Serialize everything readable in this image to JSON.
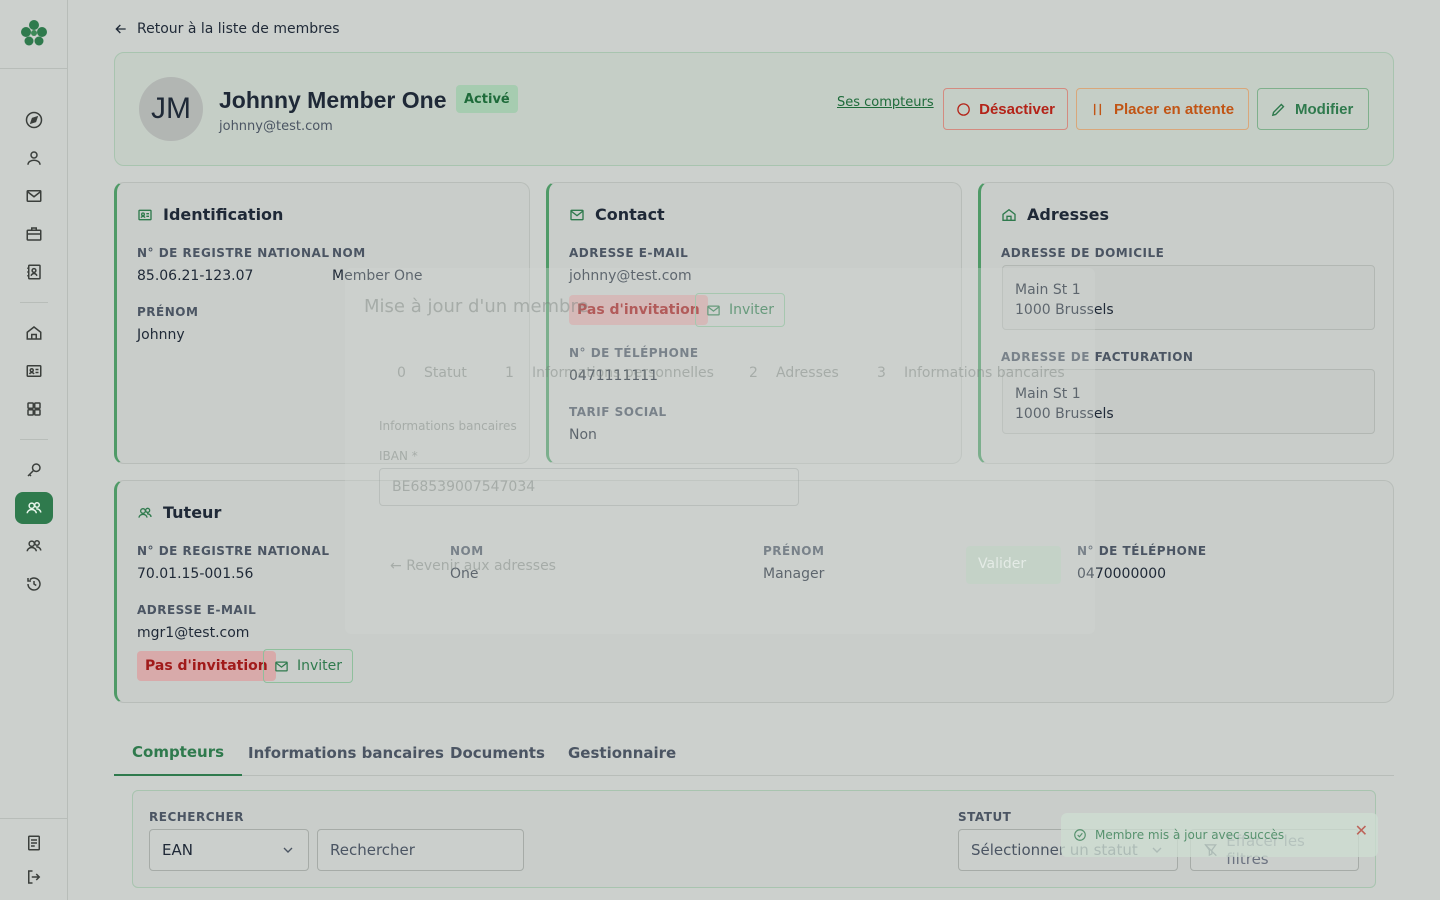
{
  "nav": {
    "back_label": "Retour à la liste de membres"
  },
  "member": {
    "initials": "JM",
    "name": "Johnny Member One",
    "status": "Activé",
    "email": "johnny@test.com",
    "meters_link": "Ses compteurs",
    "deactivate_label": "Désactiver",
    "hold_label": "Placer en attente",
    "edit_label": "Modifier"
  },
  "identification": {
    "title": "Identification",
    "nrn_label": "N° DE REGISTRE NATIONAL",
    "nrn_value": "85.06.21-123.07",
    "name_label": "NOM",
    "name_value": "Member One",
    "firstname_label": "PRÉNOM",
    "firstname_value": "Johnny"
  },
  "contact": {
    "title": "Contact",
    "email_label": "ADRESSE E-MAIL",
    "email_value": "johnny@test.com",
    "invitation_status": "Pas d'invitation",
    "invite_label": "Inviter",
    "phone_label": "N° DE TÉLÉPHONE",
    "phone_value": "0471111111",
    "tariff_label": "TARIF SOCIAL",
    "tariff_value": "Non"
  },
  "addresses": {
    "title": "Adresses",
    "home_label": "ADRESSE DE DOMICILE",
    "home_line1": "Main St 1",
    "home_line2": "1000 Brussels",
    "billing_label": "ADRESSE DE FACTURATION",
    "billing_line1": "Main St 1",
    "billing_line2": "1000 Brussels"
  },
  "guardian": {
    "title": "Tuteur",
    "nrn_label": "N° DE REGISTRE NATIONAL",
    "nrn_value": "70.01.15-001.56",
    "name_label": "NOM",
    "name_value": "One",
    "firstname_label": "PRÉNOM",
    "firstname_value": "Manager",
    "phone_label": "N° DE TÉLÉPHONE",
    "phone_value": "0470000000",
    "email_label": "ADRESSE E-MAIL",
    "email_value": "mgr1@test.com",
    "invitation_status": "Pas d'invitation",
    "invite_label": "Inviter"
  },
  "tabs": [
    "Compteurs",
    "Informations bancaires",
    "Documents",
    "Gestionnaire"
  ],
  "filters": {
    "search_label": "RECHERCHER",
    "search_type": "EAN",
    "search_placeholder": "Rechercher",
    "status_label": "STATUT",
    "status_placeholder": "Sélectionner un statut",
    "clear_label": "Effacer les filtres"
  },
  "ghost_modal": {
    "title": "Mise à jour d'un membre",
    "step0": "0",
    "step0_label": "Statut",
    "step1": "1",
    "step1_label": "Informations personnelles",
    "step2": "2",
    "step2_label": "Adresses",
    "step3": "3",
    "step3_label": "Informations bancaires",
    "section": "Informations bancaires",
    "iban_label": "IBAN *",
    "iban_value": "BE68539007547034",
    "back_label": "Revenir aux adresses",
    "submit_label": "Valider"
  },
  "toast": {
    "message": "Membre mis à jour avec succès"
  },
  "colors": {
    "primary": "#2f7a4d",
    "danger": "#b42318",
    "warning": "#c15515"
  }
}
